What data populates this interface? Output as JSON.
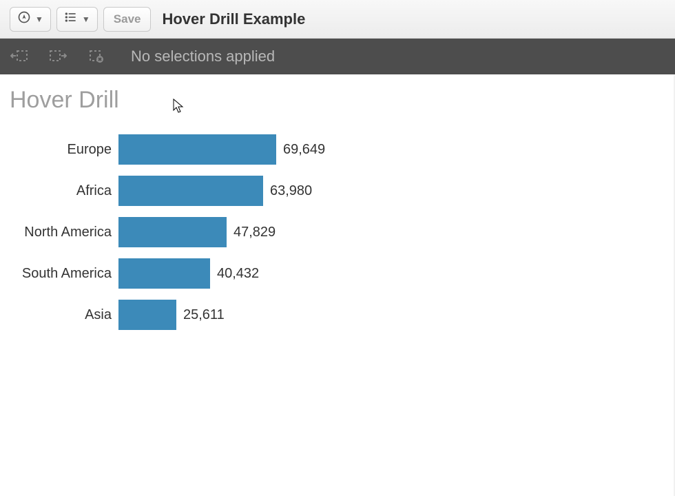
{
  "toolbar": {
    "nav_button_title": "Navigate",
    "list_button_title": "List",
    "save_label": "Save",
    "app_title": "Hover Drill Example"
  },
  "selection_bar": {
    "status_text": "No selections applied"
  },
  "sheet": {
    "title": "Hover Drill"
  },
  "chart_data": {
    "type": "bar",
    "orientation": "horizontal",
    "title": "",
    "xlabel": "",
    "ylabel": "",
    "xlim": [
      0,
      70000
    ],
    "categories": [
      "Europe",
      "Africa",
      "North America",
      "South America",
      "Asia"
    ],
    "values": [
      69649,
      63980,
      47829,
      40432,
      25611
    ],
    "value_labels": [
      "69,649",
      "63,980",
      "47,829",
      "40,432",
      "25,611"
    ],
    "bar_color": "#3c8ab9"
  }
}
